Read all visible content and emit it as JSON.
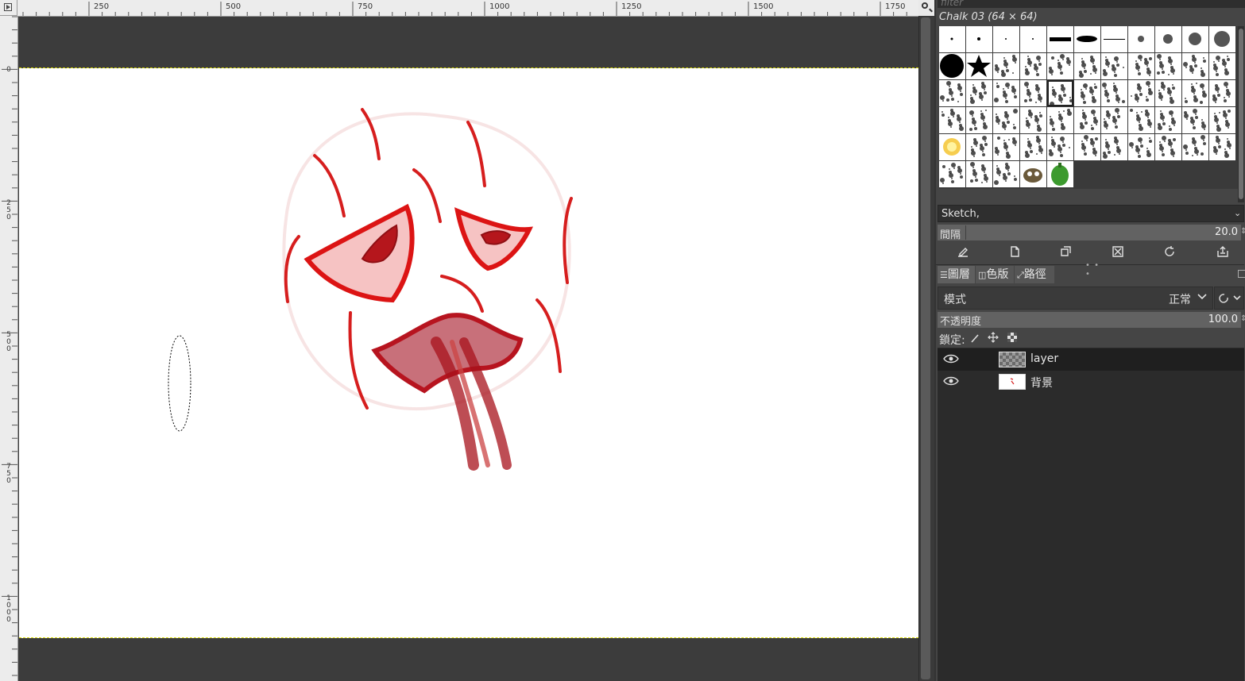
{
  "canvas": {
    "ruler_h_labels": [
      "250",
      "500",
      "750",
      "1000",
      "1250",
      "1500",
      "1750"
    ],
    "ruler_v_labels": [
      "0",
      "250",
      "500",
      "750",
      "1000"
    ]
  },
  "brushes": {
    "filter_placeholder": "filter",
    "selected_title": "Chalk 03 (64 × 64)",
    "tag_value": "Sketch,",
    "spacing_label": "間隔",
    "spacing_value": "20.0"
  },
  "layers_dock": {
    "tabs": [
      {
        "label": "圖層",
        "icon": "layers-icon"
      },
      {
        "label": "色版",
        "icon": "channels-icon"
      },
      {
        "label": "路徑",
        "icon": "paths-icon"
      }
    ],
    "mode_label": "模式",
    "mode_value": "正常",
    "opacity_label": "不透明度",
    "opacity_value": "100.0",
    "lock_label": "鎖定:",
    "layers": [
      {
        "name": "layer",
        "visible": true,
        "active": true
      },
      {
        "name": "背景",
        "visible": true,
        "active": false
      }
    ]
  },
  "colors": {
    "accent_red": "#d61e1e",
    "dock_bg": "#454545",
    "canvas_bg": "#3c3c3c"
  }
}
